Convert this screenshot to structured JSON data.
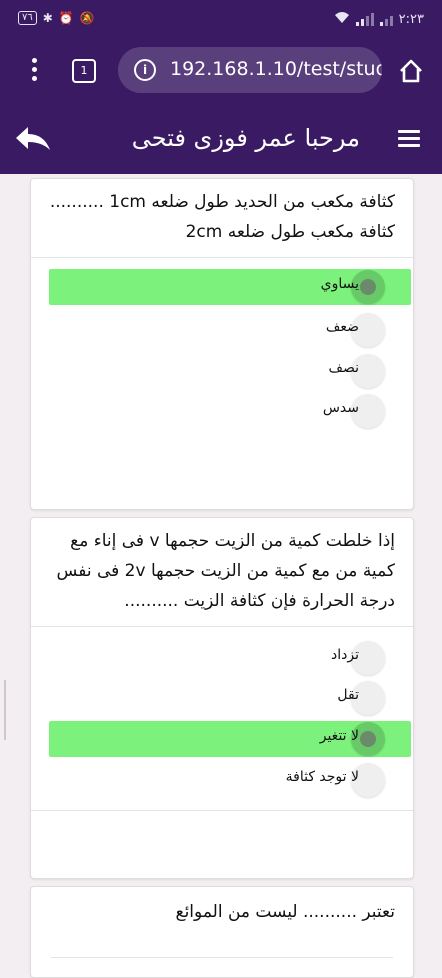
{
  "status_bar": {
    "battery": "٧٦",
    "time": "٢:٢٣"
  },
  "browser": {
    "url": "192.168.1.10/test/stud",
    "tab_count": "1"
  },
  "app_bar": {
    "title": "مرحبا عمر فوزى فتحى"
  },
  "questions": [
    {
      "text_line1": "كثافة مكعب من الحديد طول ضلعه 1cm ..........",
      "text_line2": "كثافة مكعب طول ضلعه 2cm",
      "options": [
        "يساوي",
        "ضعف",
        "نصف",
        "سدس"
      ],
      "selected": "يساوي"
    },
    {
      "text_line1": "إذا خلطت كمية من الزيت حجمها v فى إناء مع",
      "text_line2": "كمية من مع كمية من الزيت حجمها 2v فى نفس",
      "text_line3": "درجة الحرارة فإن كثافة الزيت ..........",
      "options": [
        "تزداد",
        "تقل",
        "لا تتغير",
        "لا توجد كثافة"
      ],
      "selected": "لا تتغير"
    },
    {
      "text_line1": "تعتبر .......... ليست من الموائع"
    }
  ],
  "colors": {
    "primary": "#3a1a63",
    "selected_option": "#7cf27c",
    "background": "#f3eef2"
  }
}
